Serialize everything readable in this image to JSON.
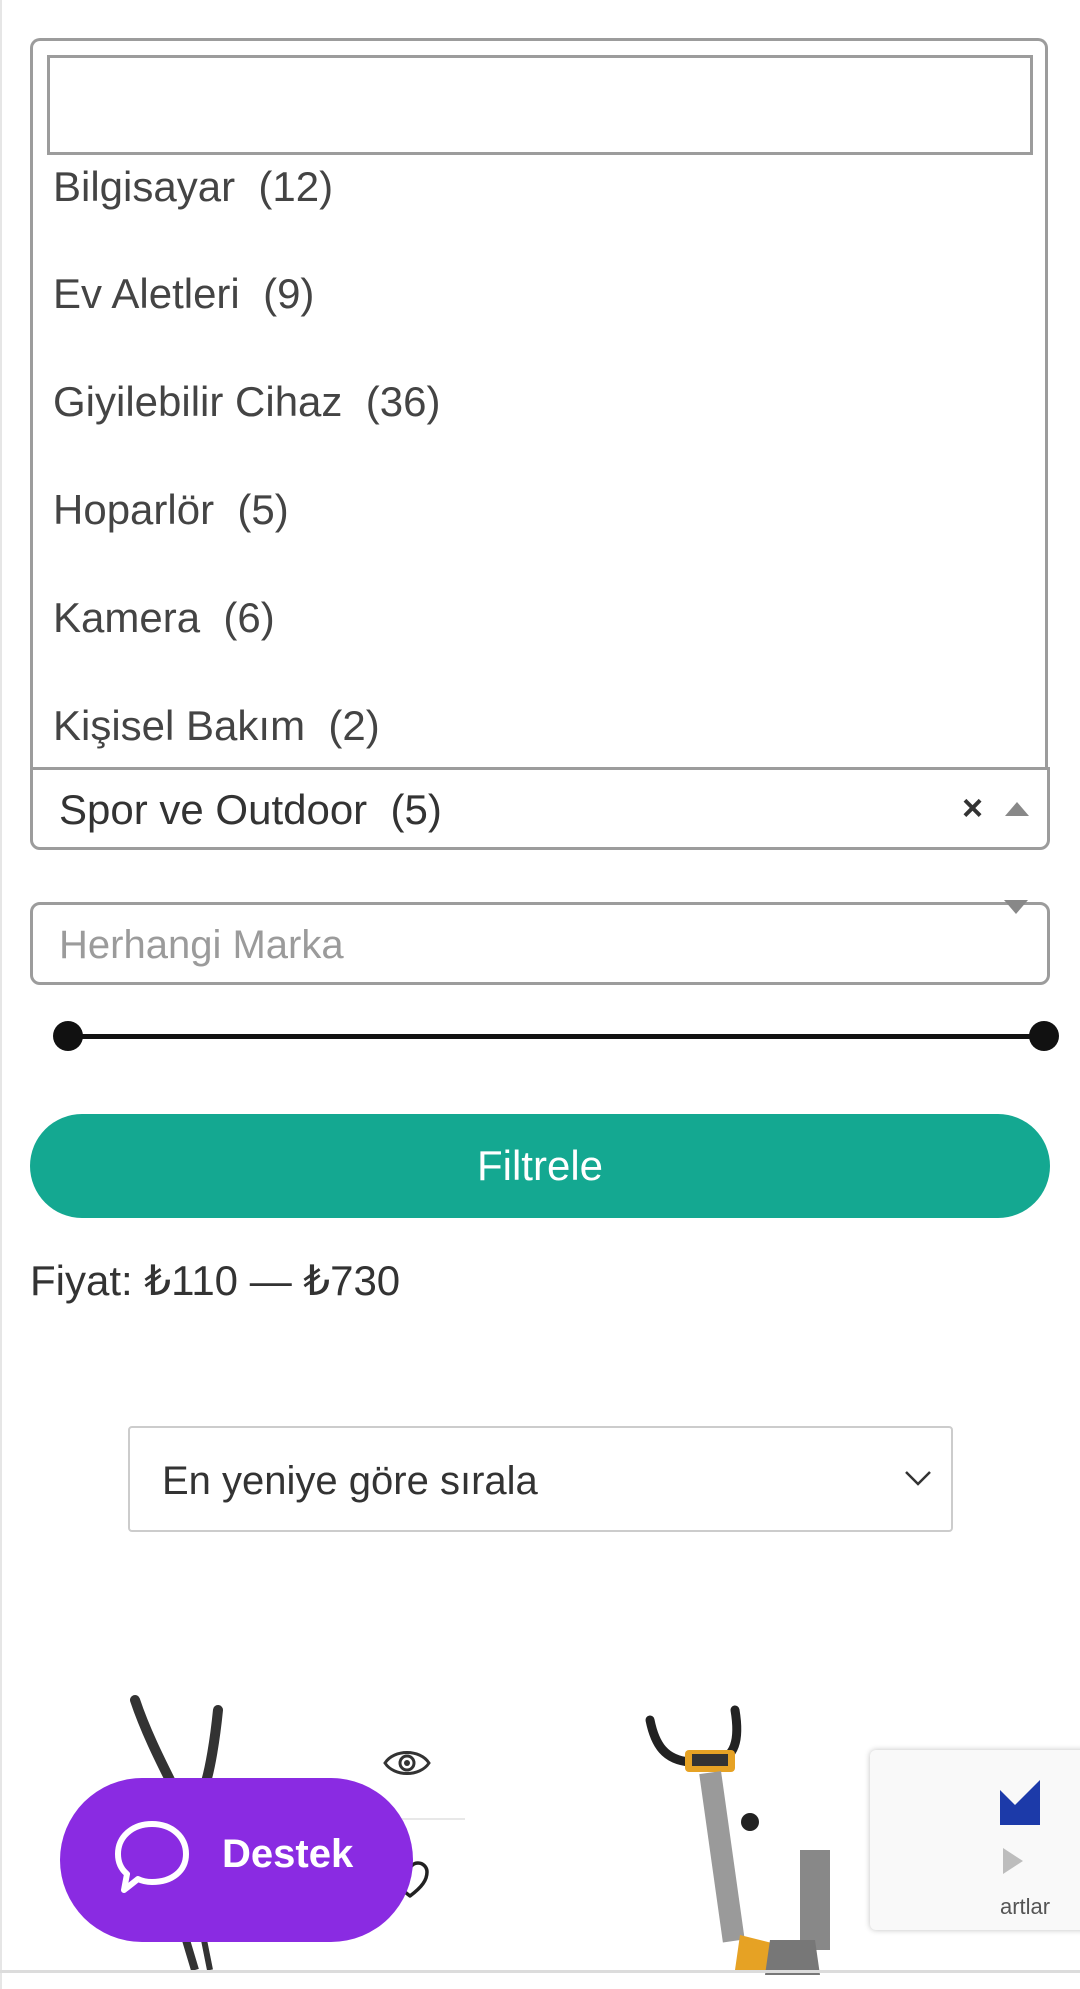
{
  "category_dropdown": {
    "search_value": "",
    "options": [
      {
        "label": "Bilgisayar  (12)"
      },
      {
        "label": "Ev Aletleri  (9)"
      },
      {
        "label": "Giyilebilir Cihaz  (36)"
      },
      {
        "label": "Hoparlör  (5)"
      },
      {
        "label": "Kamera  (6)"
      },
      {
        "label": "Kişisel Bakım  (2)"
      }
    ],
    "selected_label": "Spor ve Outdoor  (5)",
    "clear_symbol": "×"
  },
  "brand_select": {
    "placeholder": "Herhangi Marka"
  },
  "price_filter": {
    "range_min_position": 0,
    "range_max_position": 1,
    "filter_button_label": "Filtrele",
    "price_text": "Fiyat: ₺110 — ₺730"
  },
  "sort_select": {
    "value": "En yeniye göre sırala"
  },
  "support_button": {
    "label": "Destek"
  },
  "recaptcha": {
    "text": "artlar"
  },
  "colors": {
    "filter_button": "#14a891",
    "support_button": "#8a2be2",
    "border": "#9c9c9c"
  },
  "icons": [
    "clear-icon",
    "arrow-up-icon",
    "arrow-down-icon",
    "chevron-down-icon",
    "eye-icon",
    "heart-icon",
    "chat-bubble-icon"
  ]
}
